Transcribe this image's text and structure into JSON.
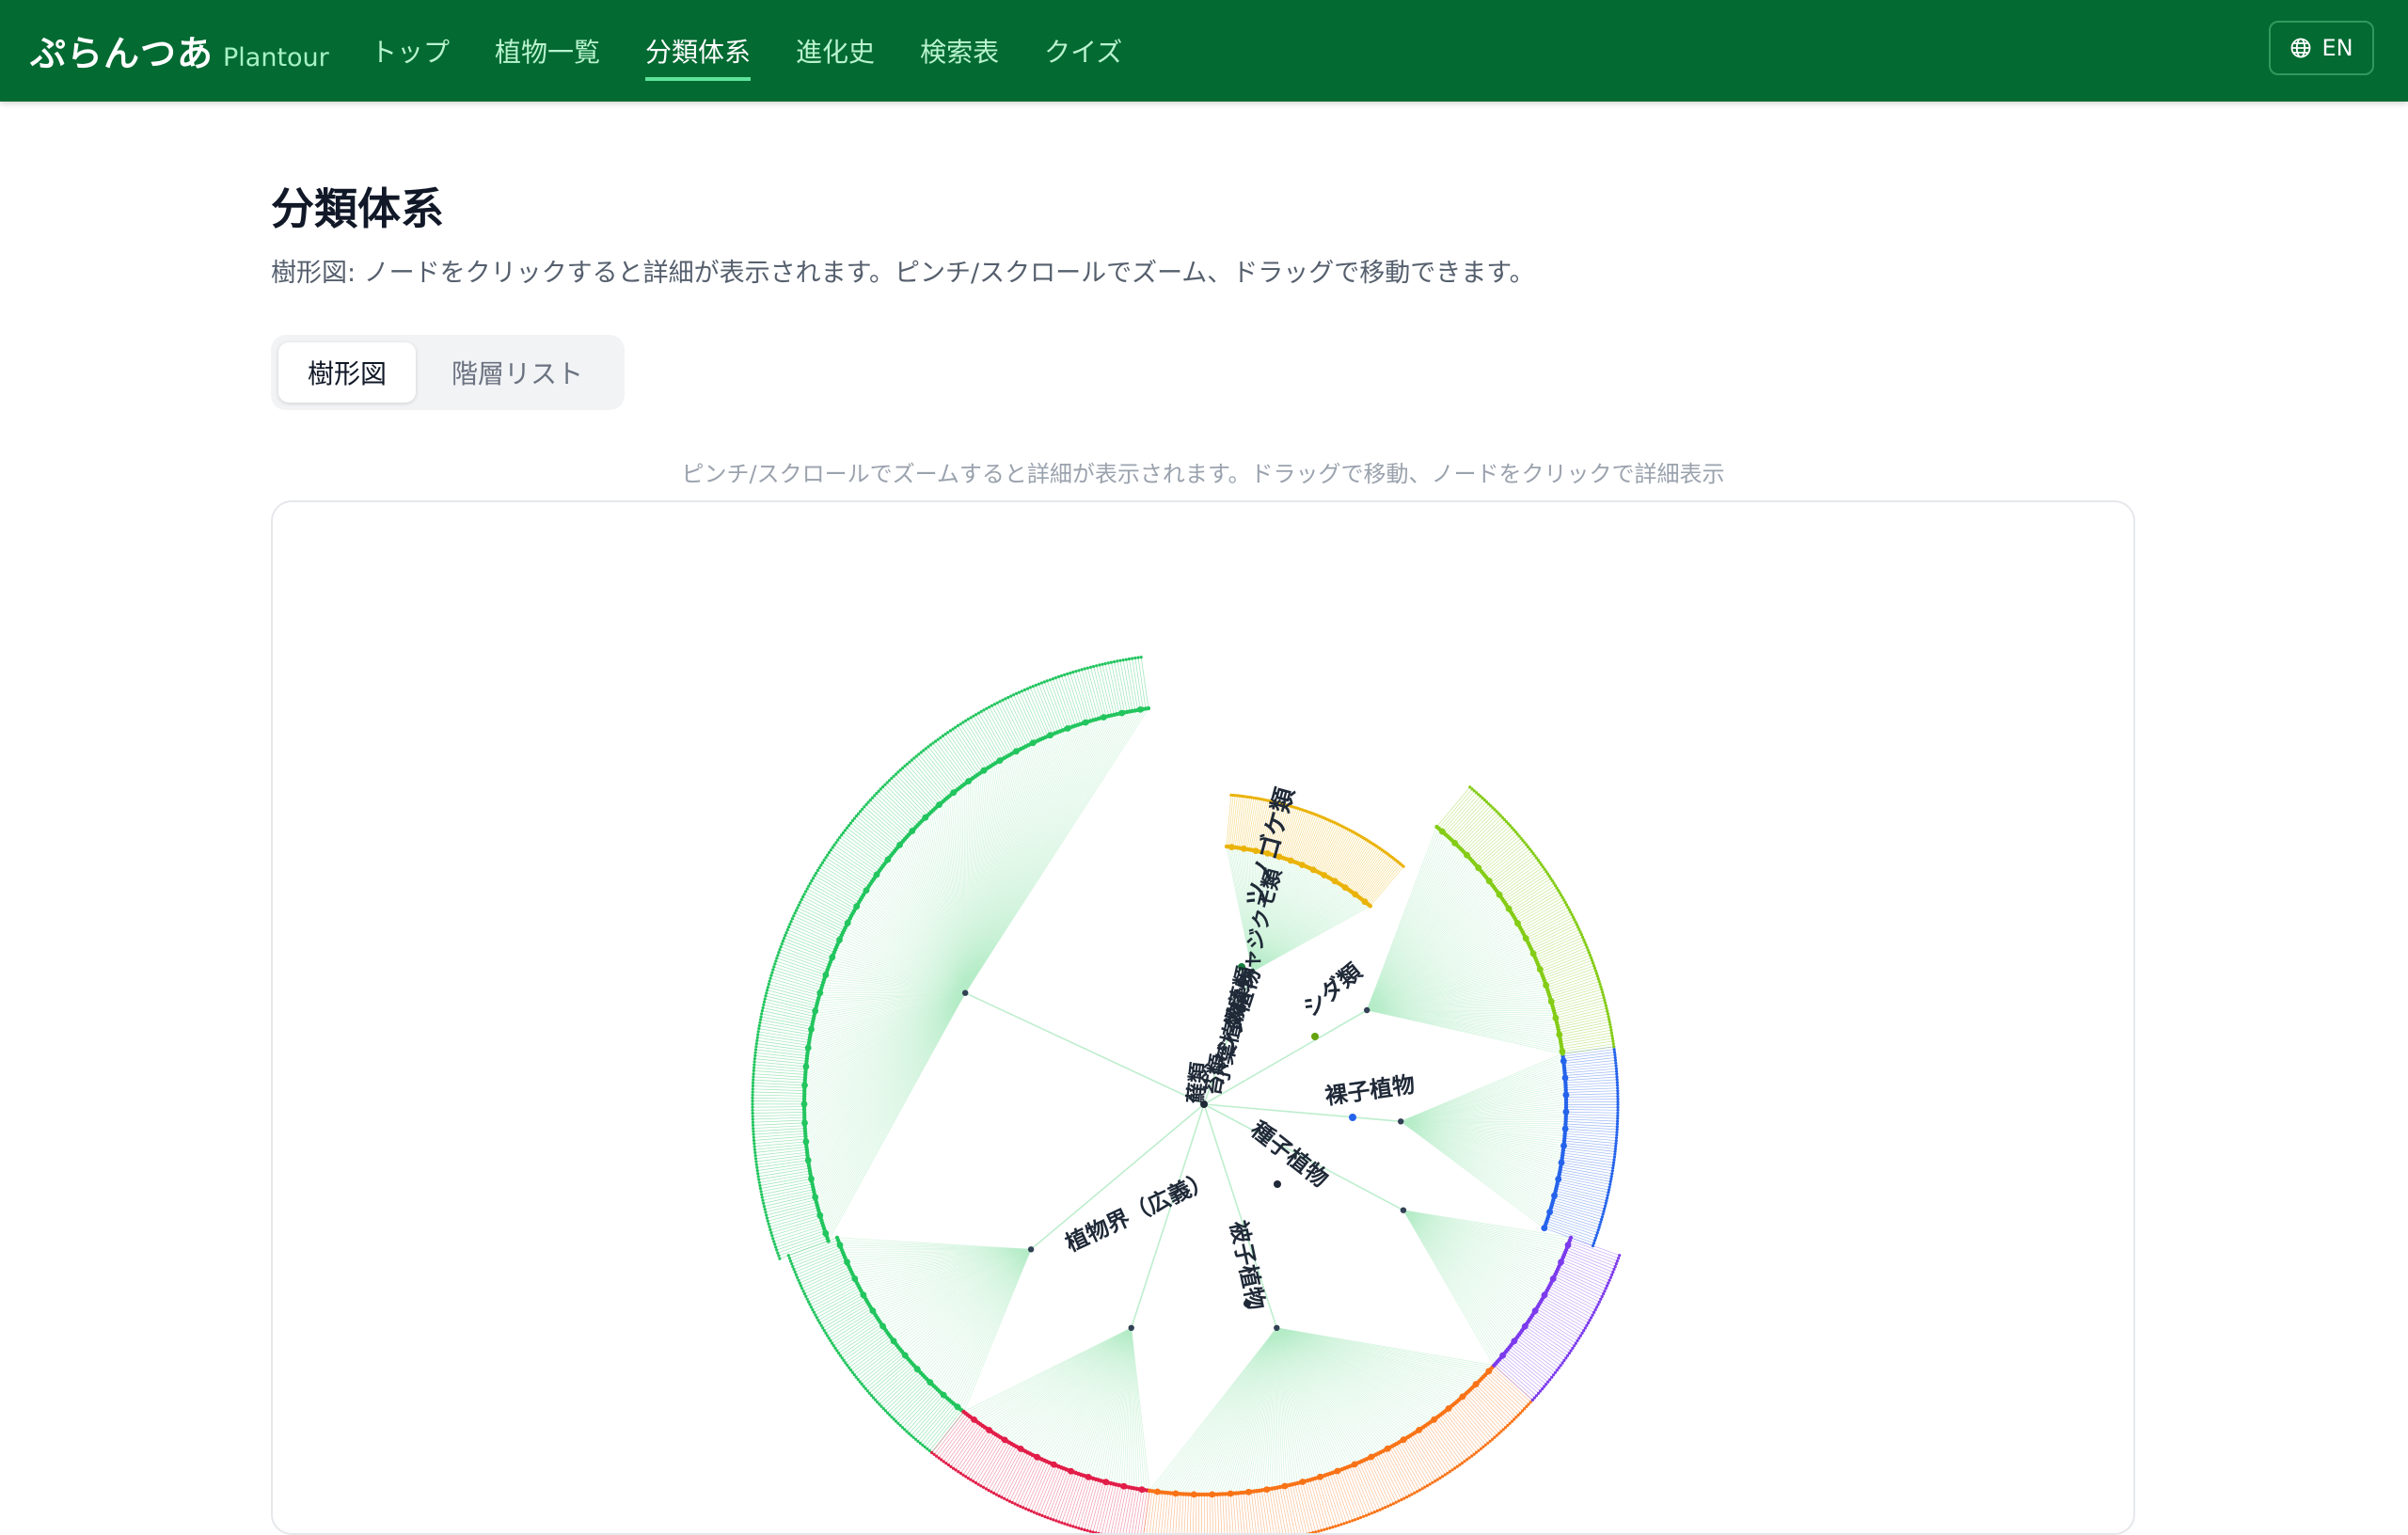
{
  "brand": {
    "name_jp": "ぷらんつあ",
    "name_en": "Plantour"
  },
  "nav": {
    "items": [
      {
        "label": "トップ",
        "name": "nav-top"
      },
      {
        "label": "植物一覧",
        "name": "nav-plant-list"
      },
      {
        "label": "分類体系",
        "name": "nav-taxonomy",
        "active": true
      },
      {
        "label": "進化史",
        "name": "nav-evolution"
      },
      {
        "label": "検索表",
        "name": "nav-key"
      },
      {
        "label": "クイズ",
        "name": "nav-quiz"
      }
    ],
    "lang_label": "EN",
    "lang_icon": "globe-icon"
  },
  "page": {
    "title": "分類体系",
    "description": "樹形図: ノードをクリックすると詳細が表示されます。ピンチ/スクロールでズーム、ドラッグで移動できます。",
    "tabs": [
      "樹形図",
      "階層リスト"
    ],
    "active_tab": "樹形図",
    "hint": "ピンチ/スクロールでズームすると詳細が表示されます。ドラッグで移動、ノードをクリックで詳細表示"
  },
  "tree": {
    "labels": [
      "植物界（広義）",
      "種子植物",
      "被子植物",
      "裸子植物",
      "シダ類",
      "シダ植物",
      "ツノゴケ類",
      "蘚類",
      "苔類",
      "小葉植物",
      "緑藻類",
      "シャジクモ類"
    ],
    "colors": {
      "link": "#b6ecc8",
      "angiosperm_branch": "#22c55e",
      "gymnosperm": "#2563eb",
      "fern": "#84cc16",
      "monocot_warm": "#f97316",
      "rosid_red": "#e11d48",
      "violet": "#7c3aed",
      "label": "#1f2937"
    }
  }
}
